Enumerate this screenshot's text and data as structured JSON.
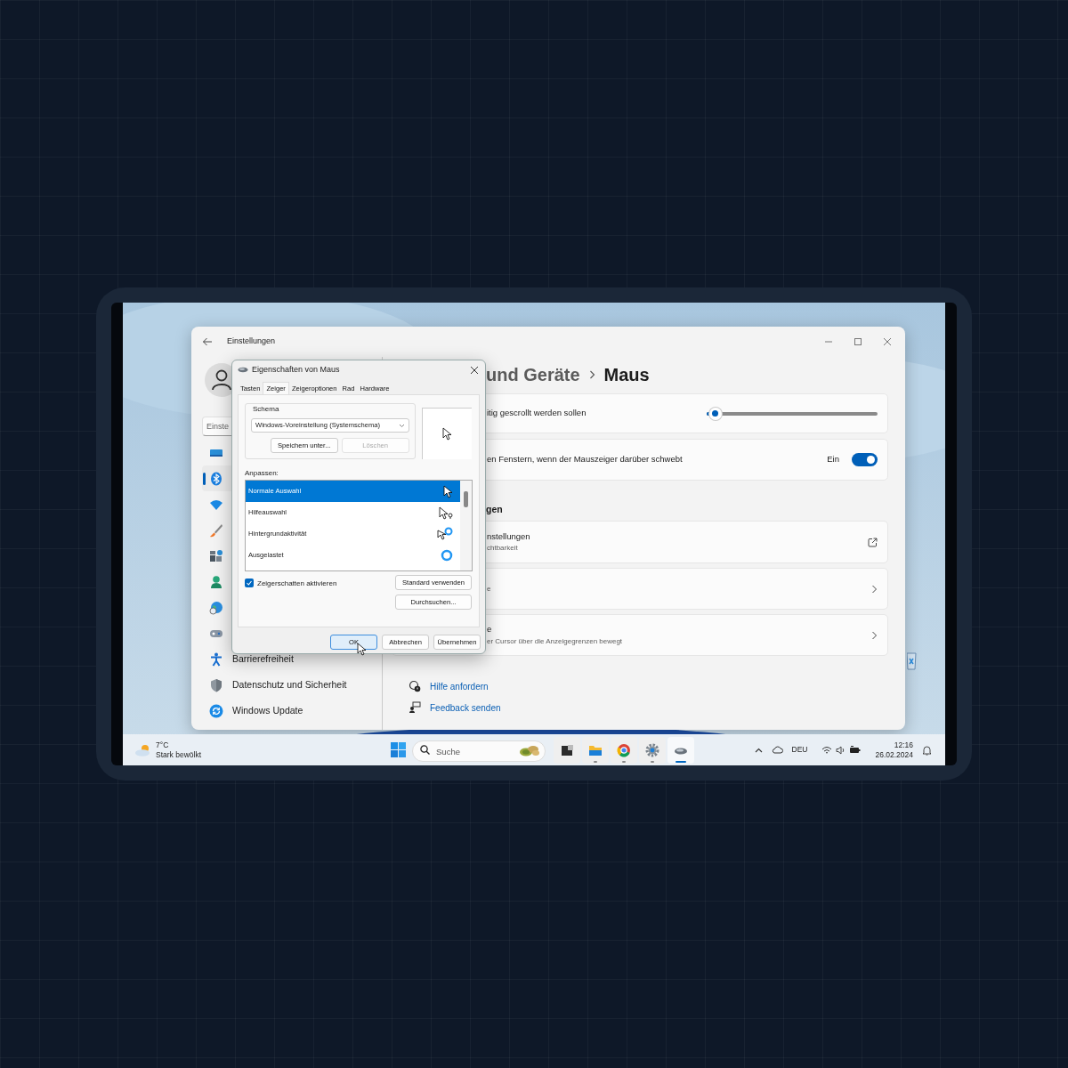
{
  "settings_window": {
    "title": "Einstellungen",
    "search": {
      "placeholder": "Einste"
    },
    "sidebar": {
      "items": [
        {
          "selected": false
        },
        {
          "selected": true
        },
        {
          "selected": false
        },
        {
          "selected": false
        },
        {
          "selected": false
        },
        {
          "selected": false
        },
        {
          "selected": false
        },
        {
          "selected": false
        },
        {
          "label": "Barrierefreiheit",
          "selected": false
        },
        {
          "label": "Datenschutz und Sicherheit",
          "selected": false
        },
        {
          "label": "Windows Update",
          "selected": false
        }
      ]
    },
    "breadcrumb": [
      "und Geräte",
      "Maus"
    ],
    "cards": [
      {
        "kind": "slider",
        "title": "itig gescrollt werden sollen",
        "level": 0.05
      },
      {
        "kind": "toggle",
        "title": "en Fenstern, wenn der Mauszeiger darüber schwebt",
        "state_label": "Ein",
        "on": true
      },
      {
        "kind": "heading",
        "title": "gen"
      },
      {
        "kind": "external",
        "title": "nstellungen",
        "subtitle": "chtbarkeit"
      },
      {
        "kind": "nav",
        "subtitle": "e"
      },
      {
        "kind": "nav",
        "title": "e",
        "subtitle": "er Cursor über die Anzeigegrenzen bewegt"
      }
    ],
    "links": [
      "Hilfe anfordern",
      "Feedback senden"
    ]
  },
  "mouse_dialog": {
    "title": "Eigenschaften von Maus",
    "tabs": [
      {
        "label": "Tasten",
        "selected": false
      },
      {
        "label": "Zeiger",
        "selected": true
      },
      {
        "label": "Zeigeroptionen",
        "selected": false
      },
      {
        "label": "Rad",
        "selected": false
      },
      {
        "label": "Hardware",
        "selected": false
      }
    ],
    "schema": {
      "legend": "Schema",
      "value": "Windows-Voreinstellung (Systemschema)",
      "buttons": [
        {
          "label": "Speichern unter...",
          "disabled": false
        },
        {
          "label": "Löschen",
          "disabled": true
        }
      ]
    },
    "customize_label": "Anpassen:",
    "cursors": [
      {
        "label": "Normale Auswahl",
        "selected": true
      },
      {
        "label": "Hilfeauswahl",
        "selected": false
      },
      {
        "label": "Hintergrundaktivität",
        "selected": false
      },
      {
        "label": "Ausgelastet",
        "selected": false
      }
    ],
    "shadow": {
      "label": "Zeigerschatten aktivieren",
      "checked": true
    },
    "side_buttons": [
      "Standard verwenden",
      "Durchsuchen..."
    ],
    "buttons": [
      {
        "label": "OK",
        "default": true
      },
      {
        "label": "Abbrechen",
        "default": false
      },
      {
        "label": "Übernehmen",
        "default": false
      }
    ]
  },
  "taskbar": {
    "weather": {
      "temperature": "7°C",
      "condition": "Stark bewölkt"
    },
    "search": {
      "placeholder": "Suche"
    },
    "apps": [
      {
        "running": false,
        "selected": false
      },
      {
        "running": true,
        "selected": false
      },
      {
        "running": true,
        "selected": false
      },
      {
        "running": true,
        "selected": false
      },
      {
        "running": true,
        "selected": true
      }
    ],
    "language": "DEU",
    "time": "12:16",
    "date": "26.02.2024"
  }
}
